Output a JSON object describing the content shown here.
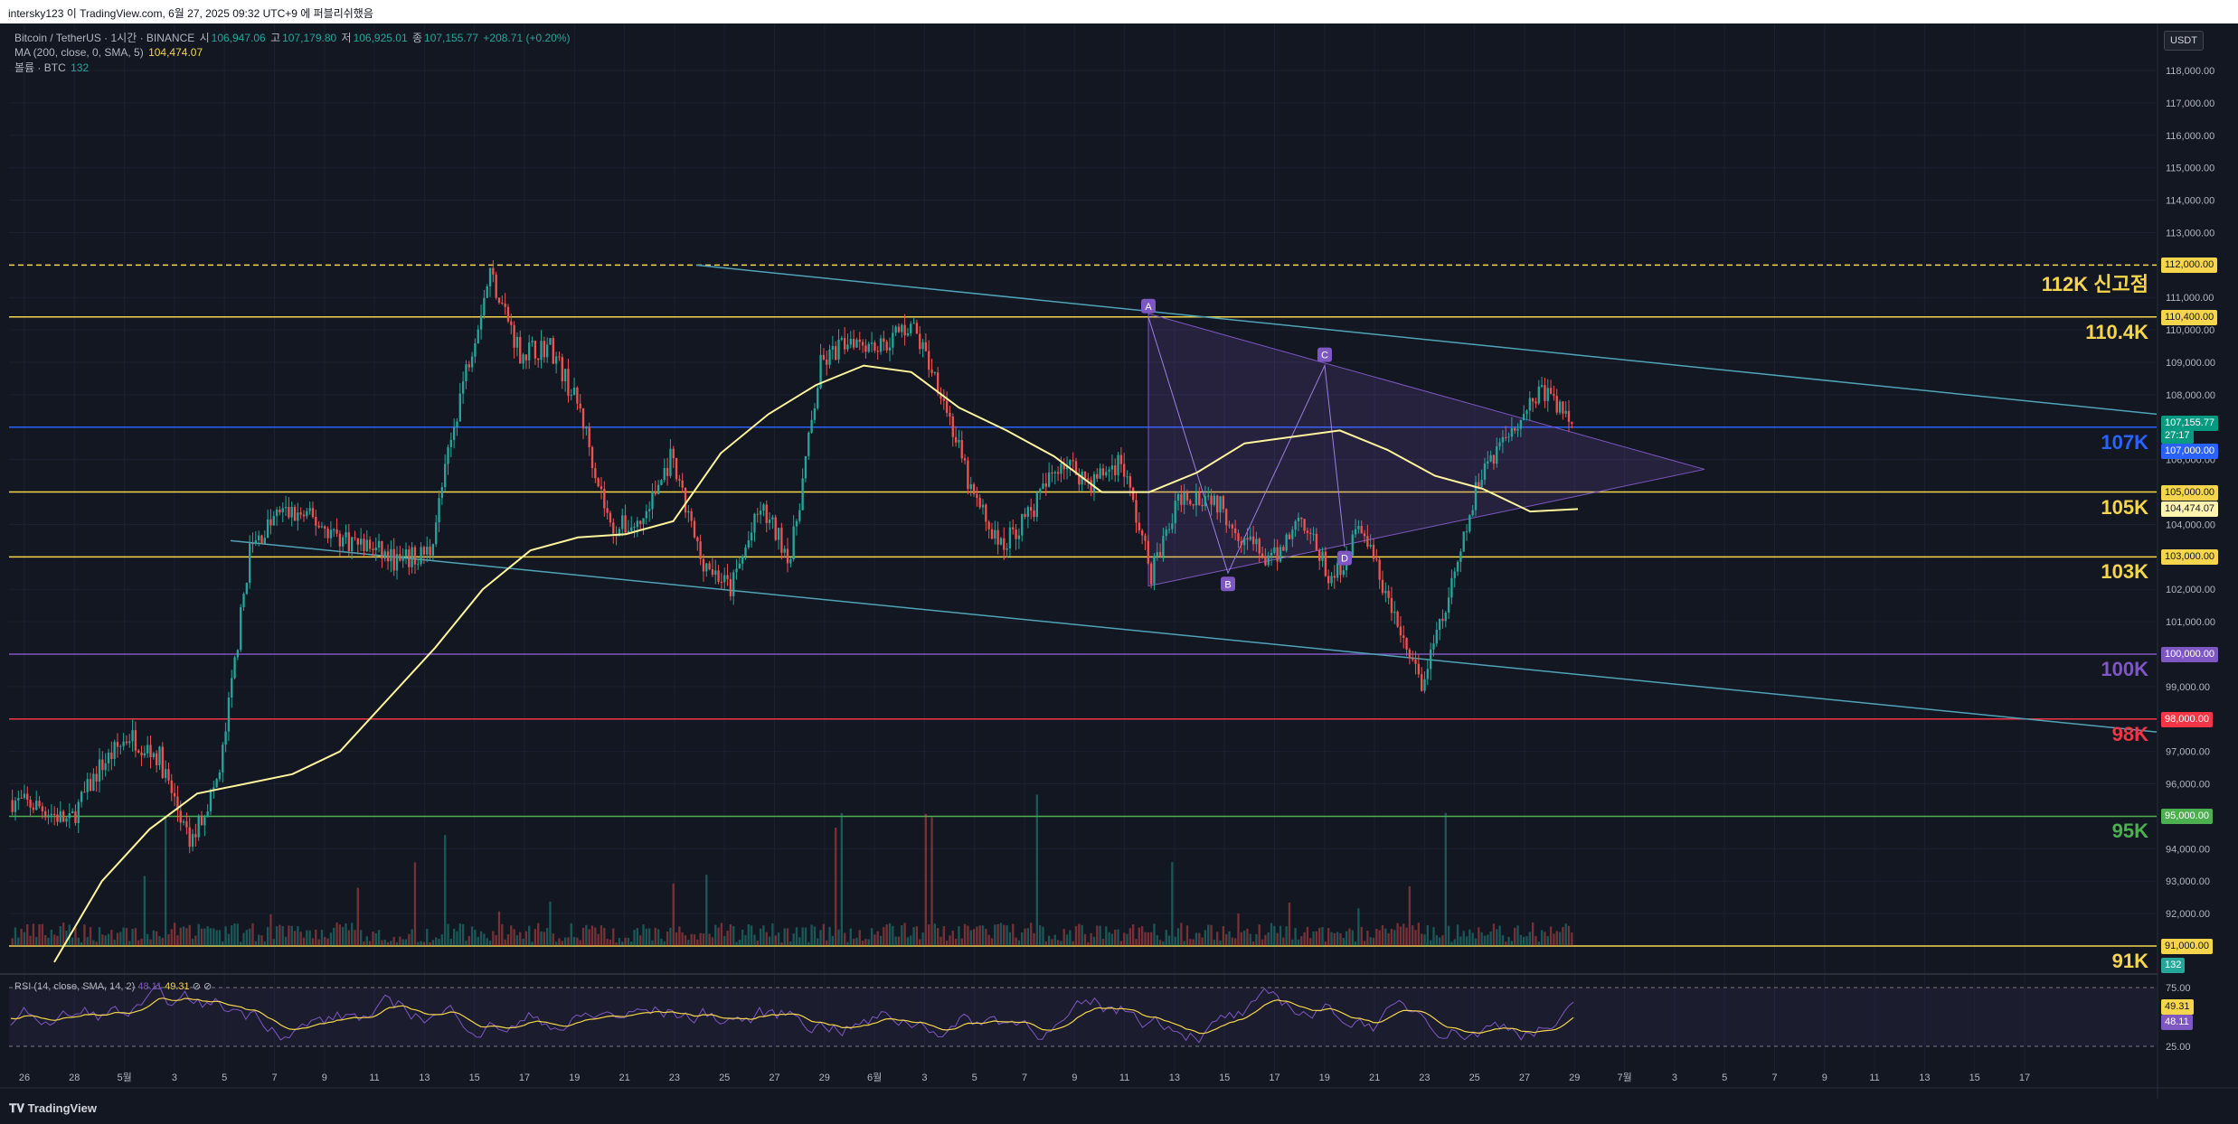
{
  "topbar": {
    "text": "intersky123 이 TradingView.com, 6월 27, 2025 09:32 UTC+9 에 퍼블리쉬했음"
  },
  "legend": {
    "symbol": "Bitcoin / TetherUS · 1시간 · BINANCE",
    "open_label": "시",
    "open": "106,947.06",
    "high_label": "고",
    "high": "107,179.80",
    "low_label": "저",
    "low": "106,925.01",
    "close_label": "종",
    "close": "107,155.77",
    "change": "+208.71 (+0.20%)",
    "ma_label": "MA (200, close, 0, SMA, 5)",
    "ma_value": "104,474.07",
    "volume_label": "볼륨 · BTC",
    "volume_value": "132"
  },
  "currency_button": "USDT",
  "price_axis": [
    "118,000.00",
    "117,000.00",
    "116,000.00",
    "115,000.00",
    "114,000.00",
    "113,000.00",
    "112,000.00",
    "111,000.00",
    "110,000.00",
    "109,000.00",
    "108,000.00",
    "107,000.00",
    "106,000.00",
    "105,000.00",
    "104,000.00",
    "103,000.00",
    "102,000.00",
    "101,000.00",
    "100,000.00",
    "99,000.00",
    "98,000.00",
    "97,000.00",
    "96,000.00",
    "95,000.00",
    "94,000.00",
    "93,000.00",
    "92,000.00",
    "91,000.00"
  ],
  "price_tags": [
    {
      "value": "112,000.00",
      "bg": "#f5d54b",
      "fg": "#131722"
    },
    {
      "value": "110,400.00",
      "bg": "#f5d54b",
      "fg": "#131722"
    },
    {
      "value": "107,155.77",
      "bg": "#089981",
      "fg": "#ffffff"
    },
    {
      "value": "27:17",
      "bg": "#089981",
      "fg": "#ffffff"
    },
    {
      "value": "107,000.00",
      "bg": "#2962ff",
      "fg": "#ffffff"
    },
    {
      "value": "105,000.00",
      "bg": "#f5d54b",
      "fg": "#131722"
    },
    {
      "value": "104,474.07",
      "bg": "#fff3b0",
      "fg": "#131722"
    },
    {
      "value": "103,000.00",
      "bg": "#f5d54b",
      "fg": "#131722"
    },
    {
      "value": "100,000.00",
      "bg": "#7e57c2",
      "fg": "#ffffff"
    },
    {
      "value": "98,000.00",
      "bg": "#f23645",
      "fg": "#ffffff"
    },
    {
      "value": "95,000.00",
      "bg": "#4caf50",
      "fg": "#ffffff"
    },
    {
      "value": "91,000.00",
      "bg": "#f5d54b",
      "fg": "#131722"
    },
    {
      "value": "132",
      "bg": "#26a69a",
      "fg": "#ffffff"
    }
  ],
  "levels": [
    {
      "text": "112K 신고점",
      "price": 112000,
      "color": "#f5d54b",
      "dashed": true
    },
    {
      "text": "110.4K",
      "price": 110400,
      "color": "#f5d54b",
      "dashed": false
    },
    {
      "text": "107K",
      "price": 107000,
      "color": "#2962ff",
      "dashed": false
    },
    {
      "text": "105K",
      "price": 105000,
      "color": "#f5d54b",
      "dashed": false
    },
    {
      "text": "103K",
      "price": 103000,
      "color": "#f5d54b",
      "dashed": false
    },
    {
      "text": "100K",
      "price": 100000,
      "color": "#7e57c2",
      "dashed": false
    },
    {
      "text": "98K",
      "price": 98000,
      "color": "#f23645",
      "dashed": false
    },
    {
      "text": "95K",
      "price": 95000,
      "color": "#4caf50",
      "dashed": false
    },
    {
      "text": "91K",
      "price": 91000,
      "color": "#f5d54b",
      "dashed": false
    }
  ],
  "pattern_labels": [
    "A",
    "B",
    "C",
    "D"
  ],
  "rsi": {
    "label": "RSI (14, close, SMA, 14, 2)",
    "value1": "48.11",
    "value2": "49.31",
    "axis": [
      "75.00",
      "25.00"
    ],
    "tags": [
      {
        "value": "49.31",
        "bg": "#f5d54b",
        "fg": "#131722"
      },
      {
        "value": "48.11",
        "bg": "#7e57c2",
        "fg": "#ffffff"
      }
    ]
  },
  "time_axis": [
    "26",
    "28",
    "5월",
    "3",
    "5",
    "7",
    "9",
    "11",
    "13",
    "15",
    "17",
    "19",
    "21",
    "23",
    "25",
    "27",
    "29",
    "6월",
    "3",
    "5",
    "7",
    "9",
    "11",
    "13",
    "15",
    "17",
    "19",
    "21",
    "23",
    "25",
    "27",
    "29",
    "7월",
    "3",
    "5",
    "7",
    "9",
    "11",
    "13",
    "15",
    "17"
  ],
  "footer": {
    "logo_text": "TradingView"
  },
  "chart_data": {
    "type": "candlestick",
    "symbol": "Bitcoin / TetherUS",
    "interval": "1시간",
    "ylim": [
      90300,
      118700
    ],
    "x": [
      "26",
      "28",
      "5월",
      "3",
      "5",
      "7",
      "9",
      "11",
      "13",
      "15",
      "17",
      "19",
      "21",
      "23",
      "25",
      "27",
      "29",
      "6월",
      "3",
      "5",
      "7",
      "9",
      "11",
      "13",
      "15",
      "17",
      "19",
      "21",
      "23",
      "25",
      "27"
    ],
    "close_path": [
      95500,
      95300,
      94800,
      96500,
      97500,
      96800,
      94100,
      96300,
      103200,
      104400,
      104200,
      103600,
      103300,
      102800,
      103200,
      108000,
      111800,
      109300,
      109500,
      107500,
      103900,
      104000,
      106000,
      103000,
      102000,
      104500,
      103000,
      108900,
      109800,
      109500,
      110200,
      108200,
      105000,
      103300,
      104400,
      106000,
      105300,
      106000,
      102500,
      104900,
      104900,
      103700,
      102800,
      104300,
      102200,
      104000,
      101300,
      99000,
      102000,
      105700,
      107000,
      108200,
      107155
    ],
    "ma200_path": [
      90500,
      93000,
      94600,
      95700,
      96000,
      96300,
      97000,
      98600,
      100200,
      102000,
      103200,
      103600,
      103700,
      104100,
      106200,
      107400,
      108300,
      108900,
      108700,
      107600,
      106900,
      106100,
      105000,
      105000,
      105600,
      106500,
      106700,
      106900,
      106300,
      105500,
      105100,
      104400,
      104474
    ],
    "current_price": 107155.77,
    "ma200_current": 104474.07,
    "horizontal_levels": [
      112000,
      110400,
      107000,
      105000,
      103000,
      100000,
      98000,
      95000,
      91000
    ],
    "rsi_last": 48.11,
    "rsi_ma_last": 49.31
  }
}
